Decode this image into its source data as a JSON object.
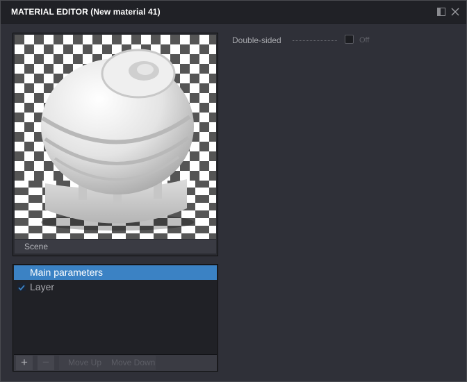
{
  "window": {
    "title": "MATERIAL EDITOR (New material 41)",
    "icons": [
      "dock-icon",
      "close-icon"
    ]
  },
  "preview": {
    "scene_label": "Scene",
    "colors": {
      "checker_light": "#ffffff",
      "checker_dark": "#555555",
      "ball": "#e4e4e4"
    }
  },
  "layers": {
    "items": [
      {
        "label": "Main parameters",
        "selected": true,
        "has_checkbox": false
      },
      {
        "label": "Layer",
        "selected": false,
        "has_checkbox": true,
        "checked": true
      }
    ],
    "toolbar": {
      "add_label": "+",
      "remove_label": "−",
      "move_up_label": "Move Up",
      "move_down_label": "Move Down"
    }
  },
  "properties": {
    "double_sided": {
      "label": "Double-sided",
      "value": "Off"
    }
  },
  "theme": {
    "accent": "#3b82c4",
    "panel_bg": "#2f3038",
    "title_bg": "#202126"
  }
}
